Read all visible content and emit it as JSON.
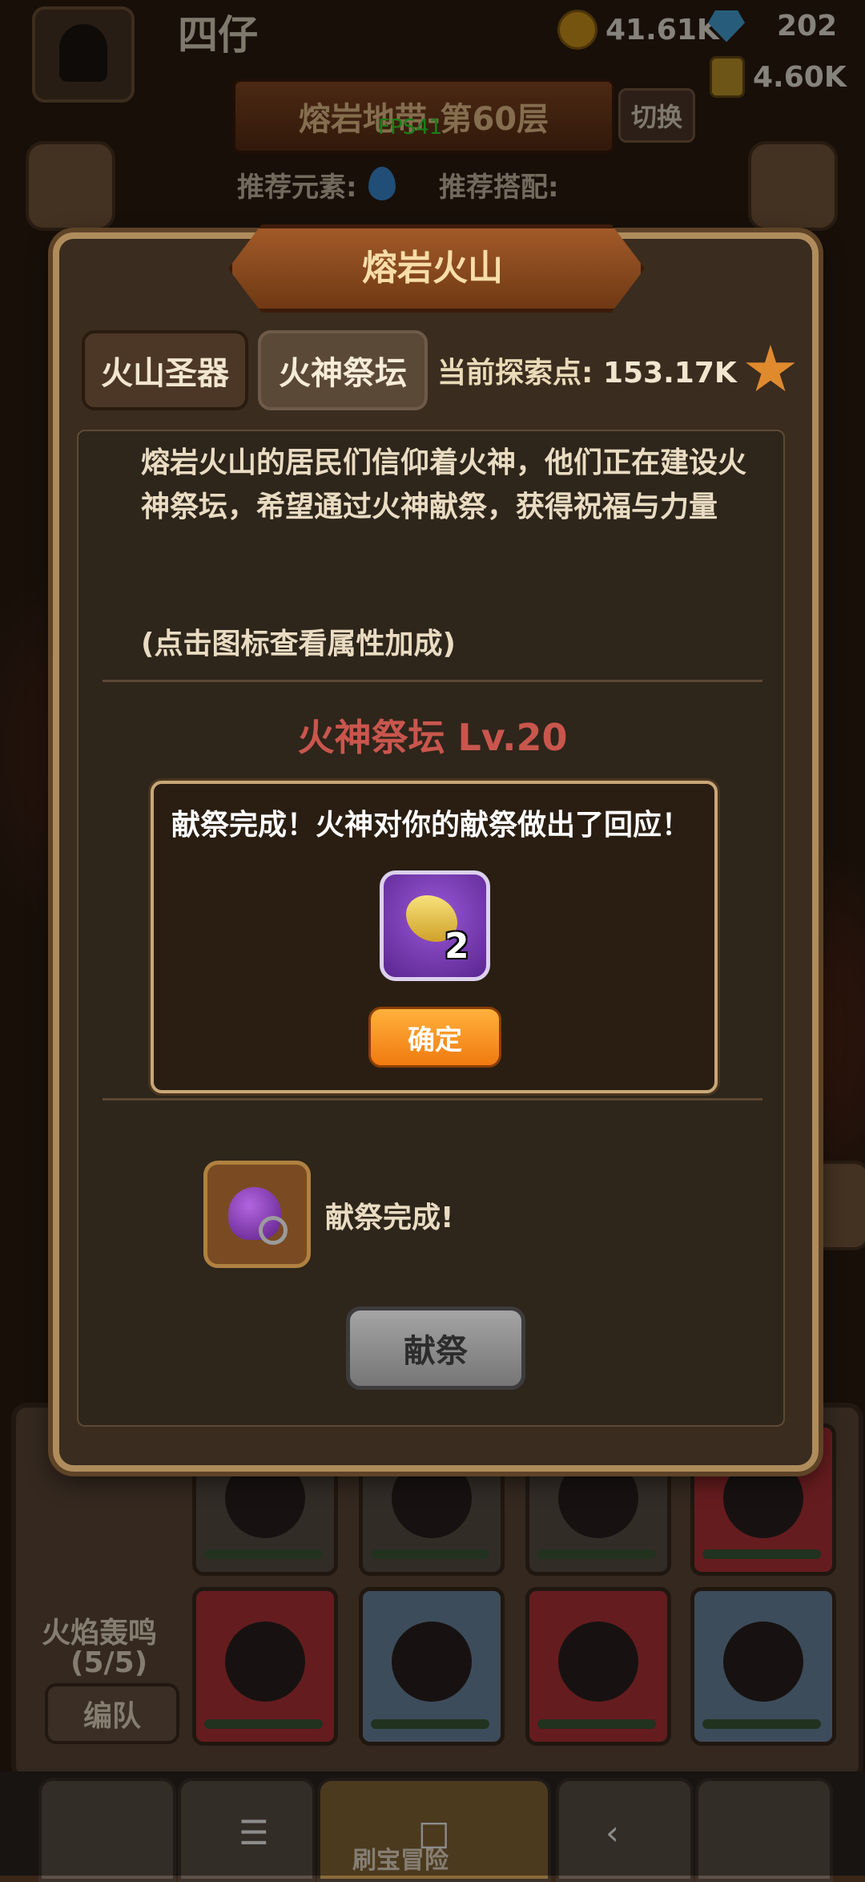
{
  "player": {
    "name": "四仔"
  },
  "resources": {
    "gold": "41.61K",
    "gems": "202",
    "stamina": "4.60K"
  },
  "stage": {
    "title": "熔岩地带-第60层",
    "switch_label": "切换",
    "fps": "FPS41"
  },
  "recommend": {
    "element_label": "推荐元素:",
    "combo_label": "推荐搭配:"
  },
  "modal": {
    "title": "熔岩火山",
    "tabs": [
      {
        "label": "火山圣器"
      },
      {
        "label": "火神祭坛"
      }
    ],
    "explore_label": "当前探索点:",
    "explore_value": "153.17K",
    "description": "熔岩火山的居民们信仰着火神，他们正在建设火神祭坛，希望通过火神献祭，获得祝福与力量",
    "hint": "(点击图标查看属性加成)",
    "altar_level": "火神祭坛 Lv.20",
    "sacrifice_status": "献祭完成!",
    "sacrifice_button": "献祭"
  },
  "popup": {
    "message": "献祭完成！火神对你的献祭做出了回应！",
    "reward_count": "2",
    "confirm_label": "确定"
  },
  "team": {
    "title": "火焰轰鸣",
    "count": "(5/5)",
    "button": "编队"
  },
  "bottom_nav": {
    "active_label": "刷宝冒险"
  },
  "colors": {
    "accent": "#f07a10",
    "modal_border": "#b08c5c",
    "level_text": "#c9564d"
  }
}
